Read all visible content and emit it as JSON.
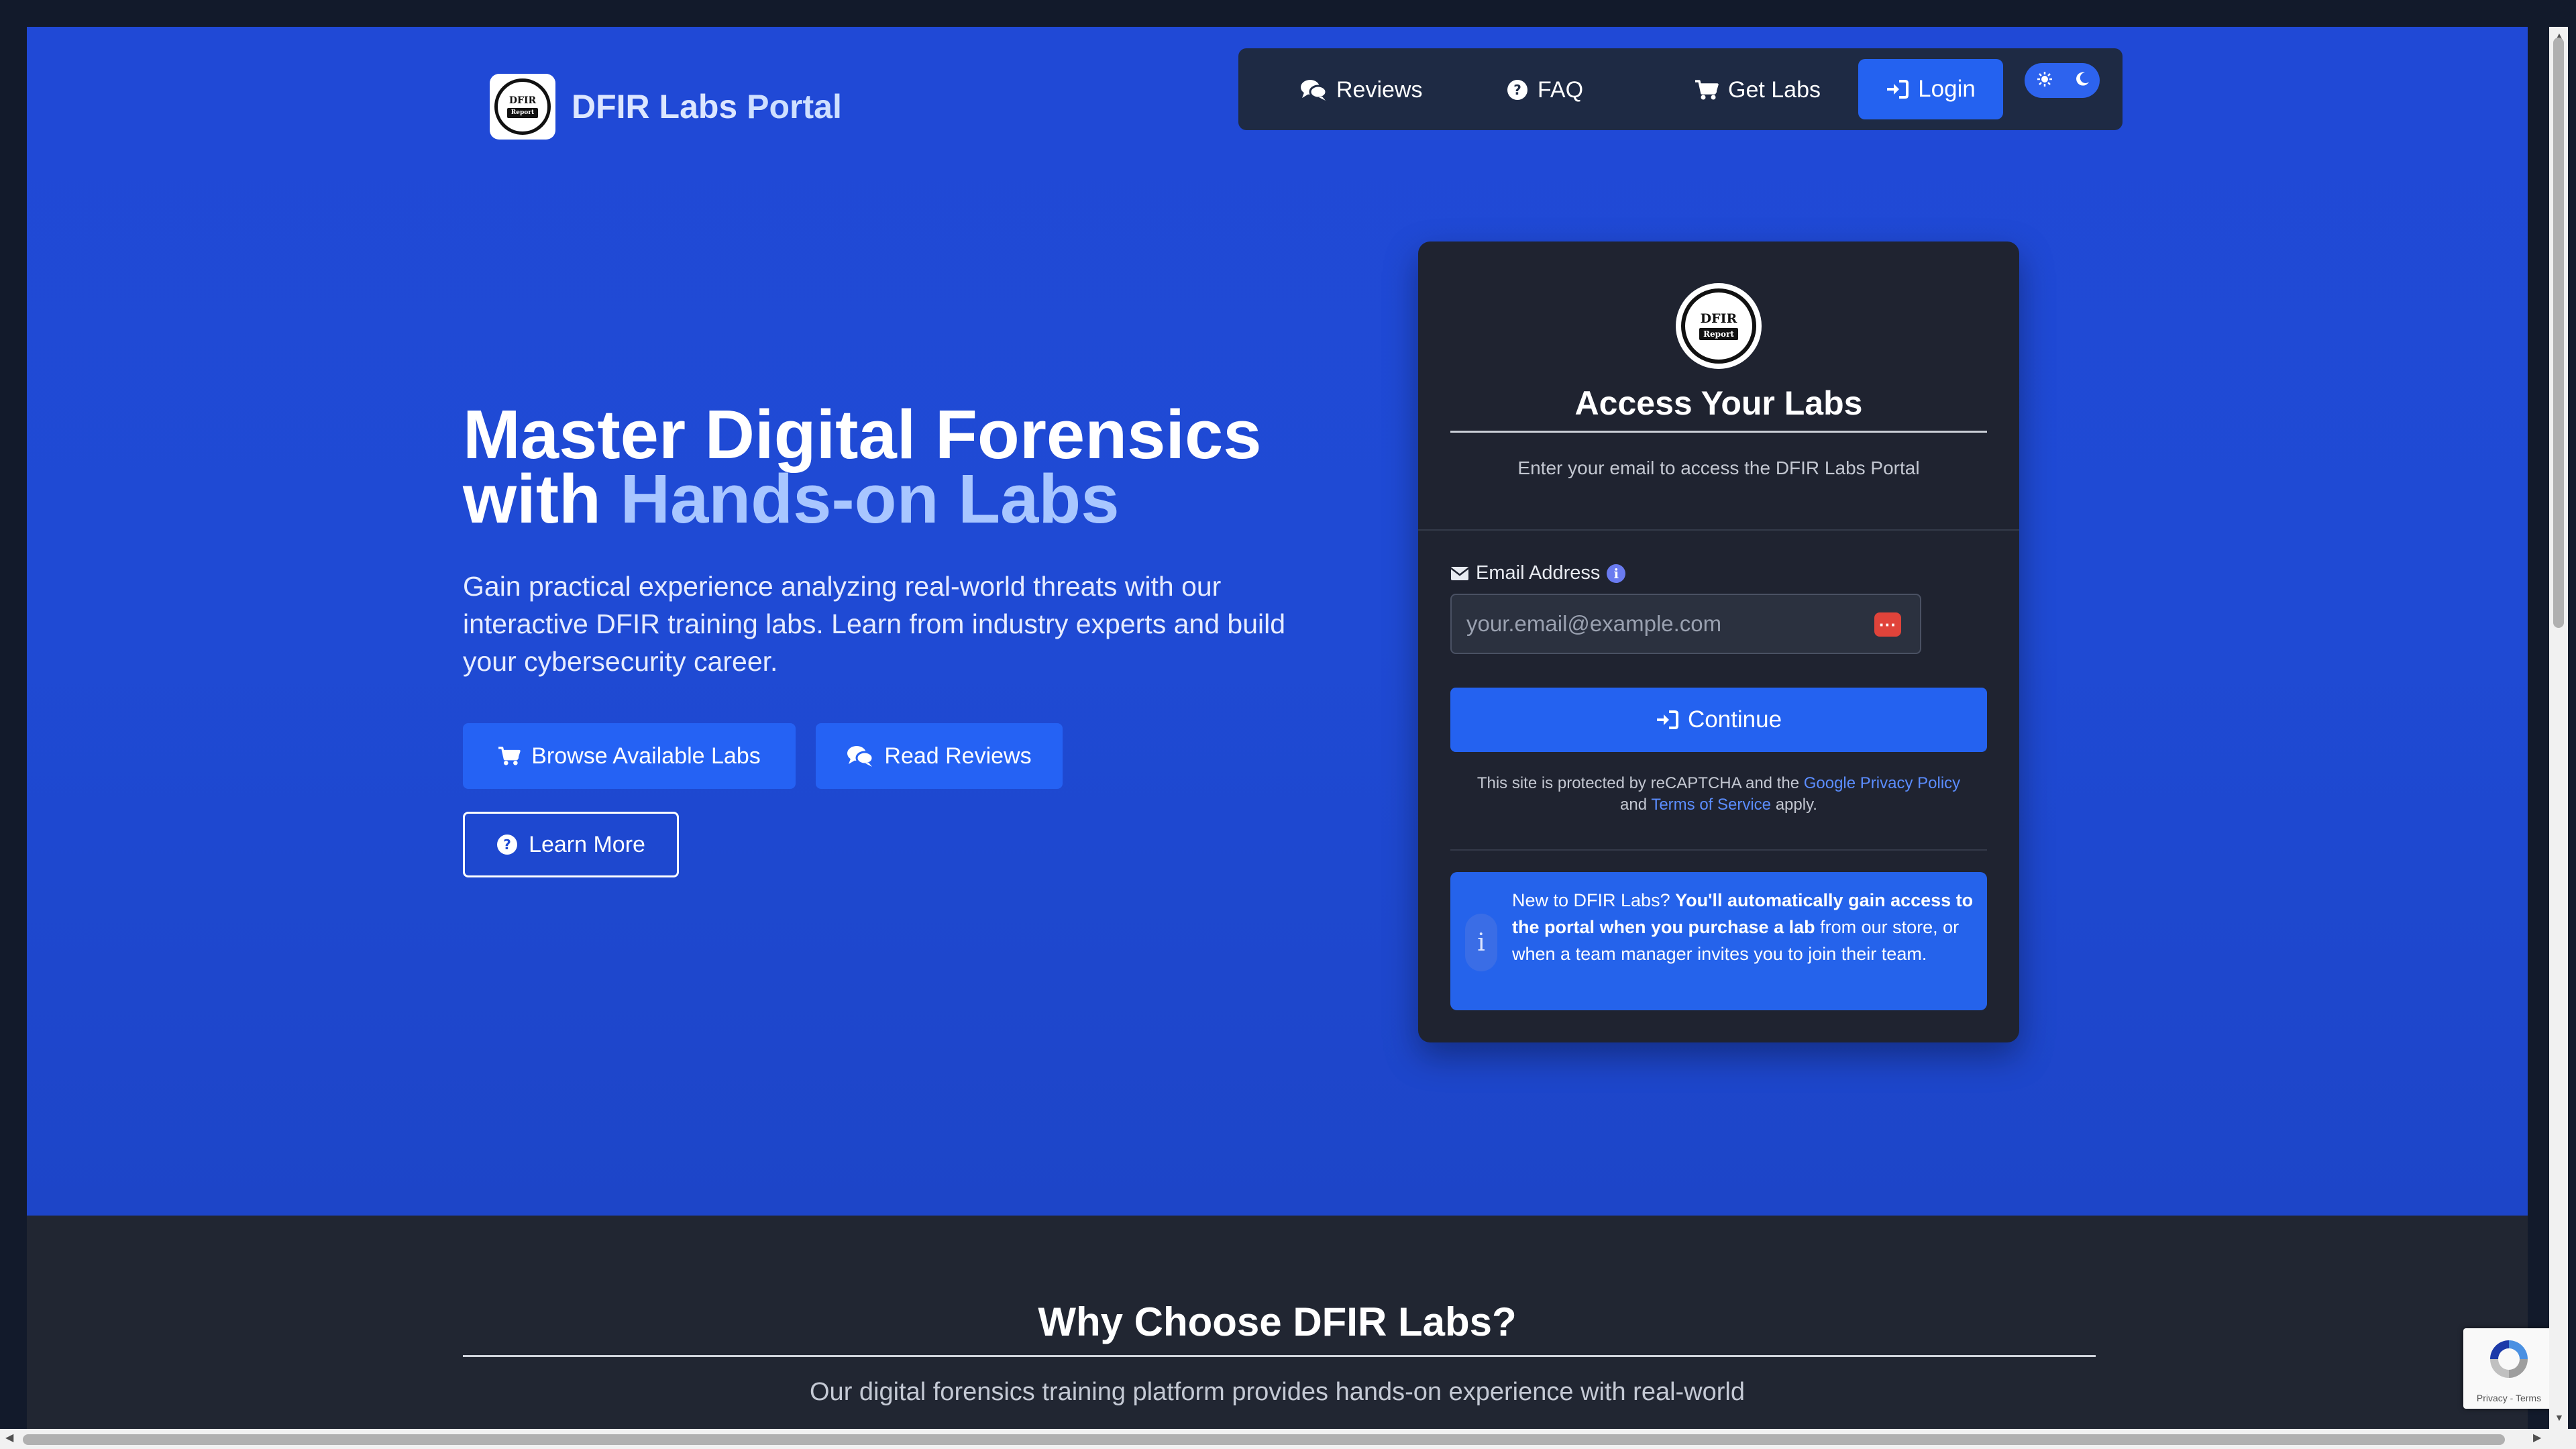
{
  "brand": {
    "name": "DFIR Labs Portal",
    "name_part1": "DFIR Labs",
    "name_part2": "Portal",
    "logo_top": "DFIR",
    "logo_bottom": "Report"
  },
  "nav": {
    "items": [
      {
        "label": "Reviews",
        "icon": "comments-icon"
      },
      {
        "label": "FAQ",
        "icon": "question-circle-icon"
      },
      {
        "label": "Get Labs",
        "icon": "cart-icon"
      }
    ],
    "login_label": "Login",
    "theme_toggle": {
      "light_icon": "sun-icon",
      "dark_icon": "moon-icon"
    }
  },
  "hero": {
    "title_line1": "Master Digital Forensics",
    "title_line2_prefix": "with ",
    "title_line2_highlight": "Hands-on Labs",
    "subtitle": "Gain practical experience analyzing real-world threats with our interactive DFIR training labs. Learn from industry experts and build your cybersecurity career.",
    "buttons": {
      "browse": "Browse Available Labs",
      "reviews": "Read Reviews",
      "learn": "Learn More"
    }
  },
  "login_card": {
    "title": "Access Your Labs",
    "subtitle": "Enter your email to access the DFIR Labs Portal",
    "email_label": "Email Address",
    "email_placeholder": "your.email@example.com",
    "email_value": "",
    "continue_label": "Continue",
    "recaptcha": {
      "prefix": "This site is protected by reCAPTCHA and the ",
      "privacy_link": "Google Privacy Policy",
      "and": " and ",
      "terms_link": "Terms of Service",
      "suffix": " apply."
    },
    "notice": {
      "prefix": "New to DFIR Labs? ",
      "bold": "You'll automatically gain access to the portal when you purchase a lab",
      "suffix": " from our store, or when a team manager invites you to join their team."
    }
  },
  "why": {
    "title": "Why Choose DFIR Labs?",
    "subtitle": "Our digital forensics training platform provides hands-on experience with real-world"
  },
  "recaptcha_badge": {
    "terms": "Privacy - Terms"
  },
  "colors": {
    "hero_bg": "#1f4ad4",
    "accent": "#2462f0",
    "card_bg": "#1f2330",
    "page_bg": "#212632",
    "nav_bg": "#1e2a44",
    "highlight": "#a8c6ff",
    "error_icon": "#e0433a"
  }
}
